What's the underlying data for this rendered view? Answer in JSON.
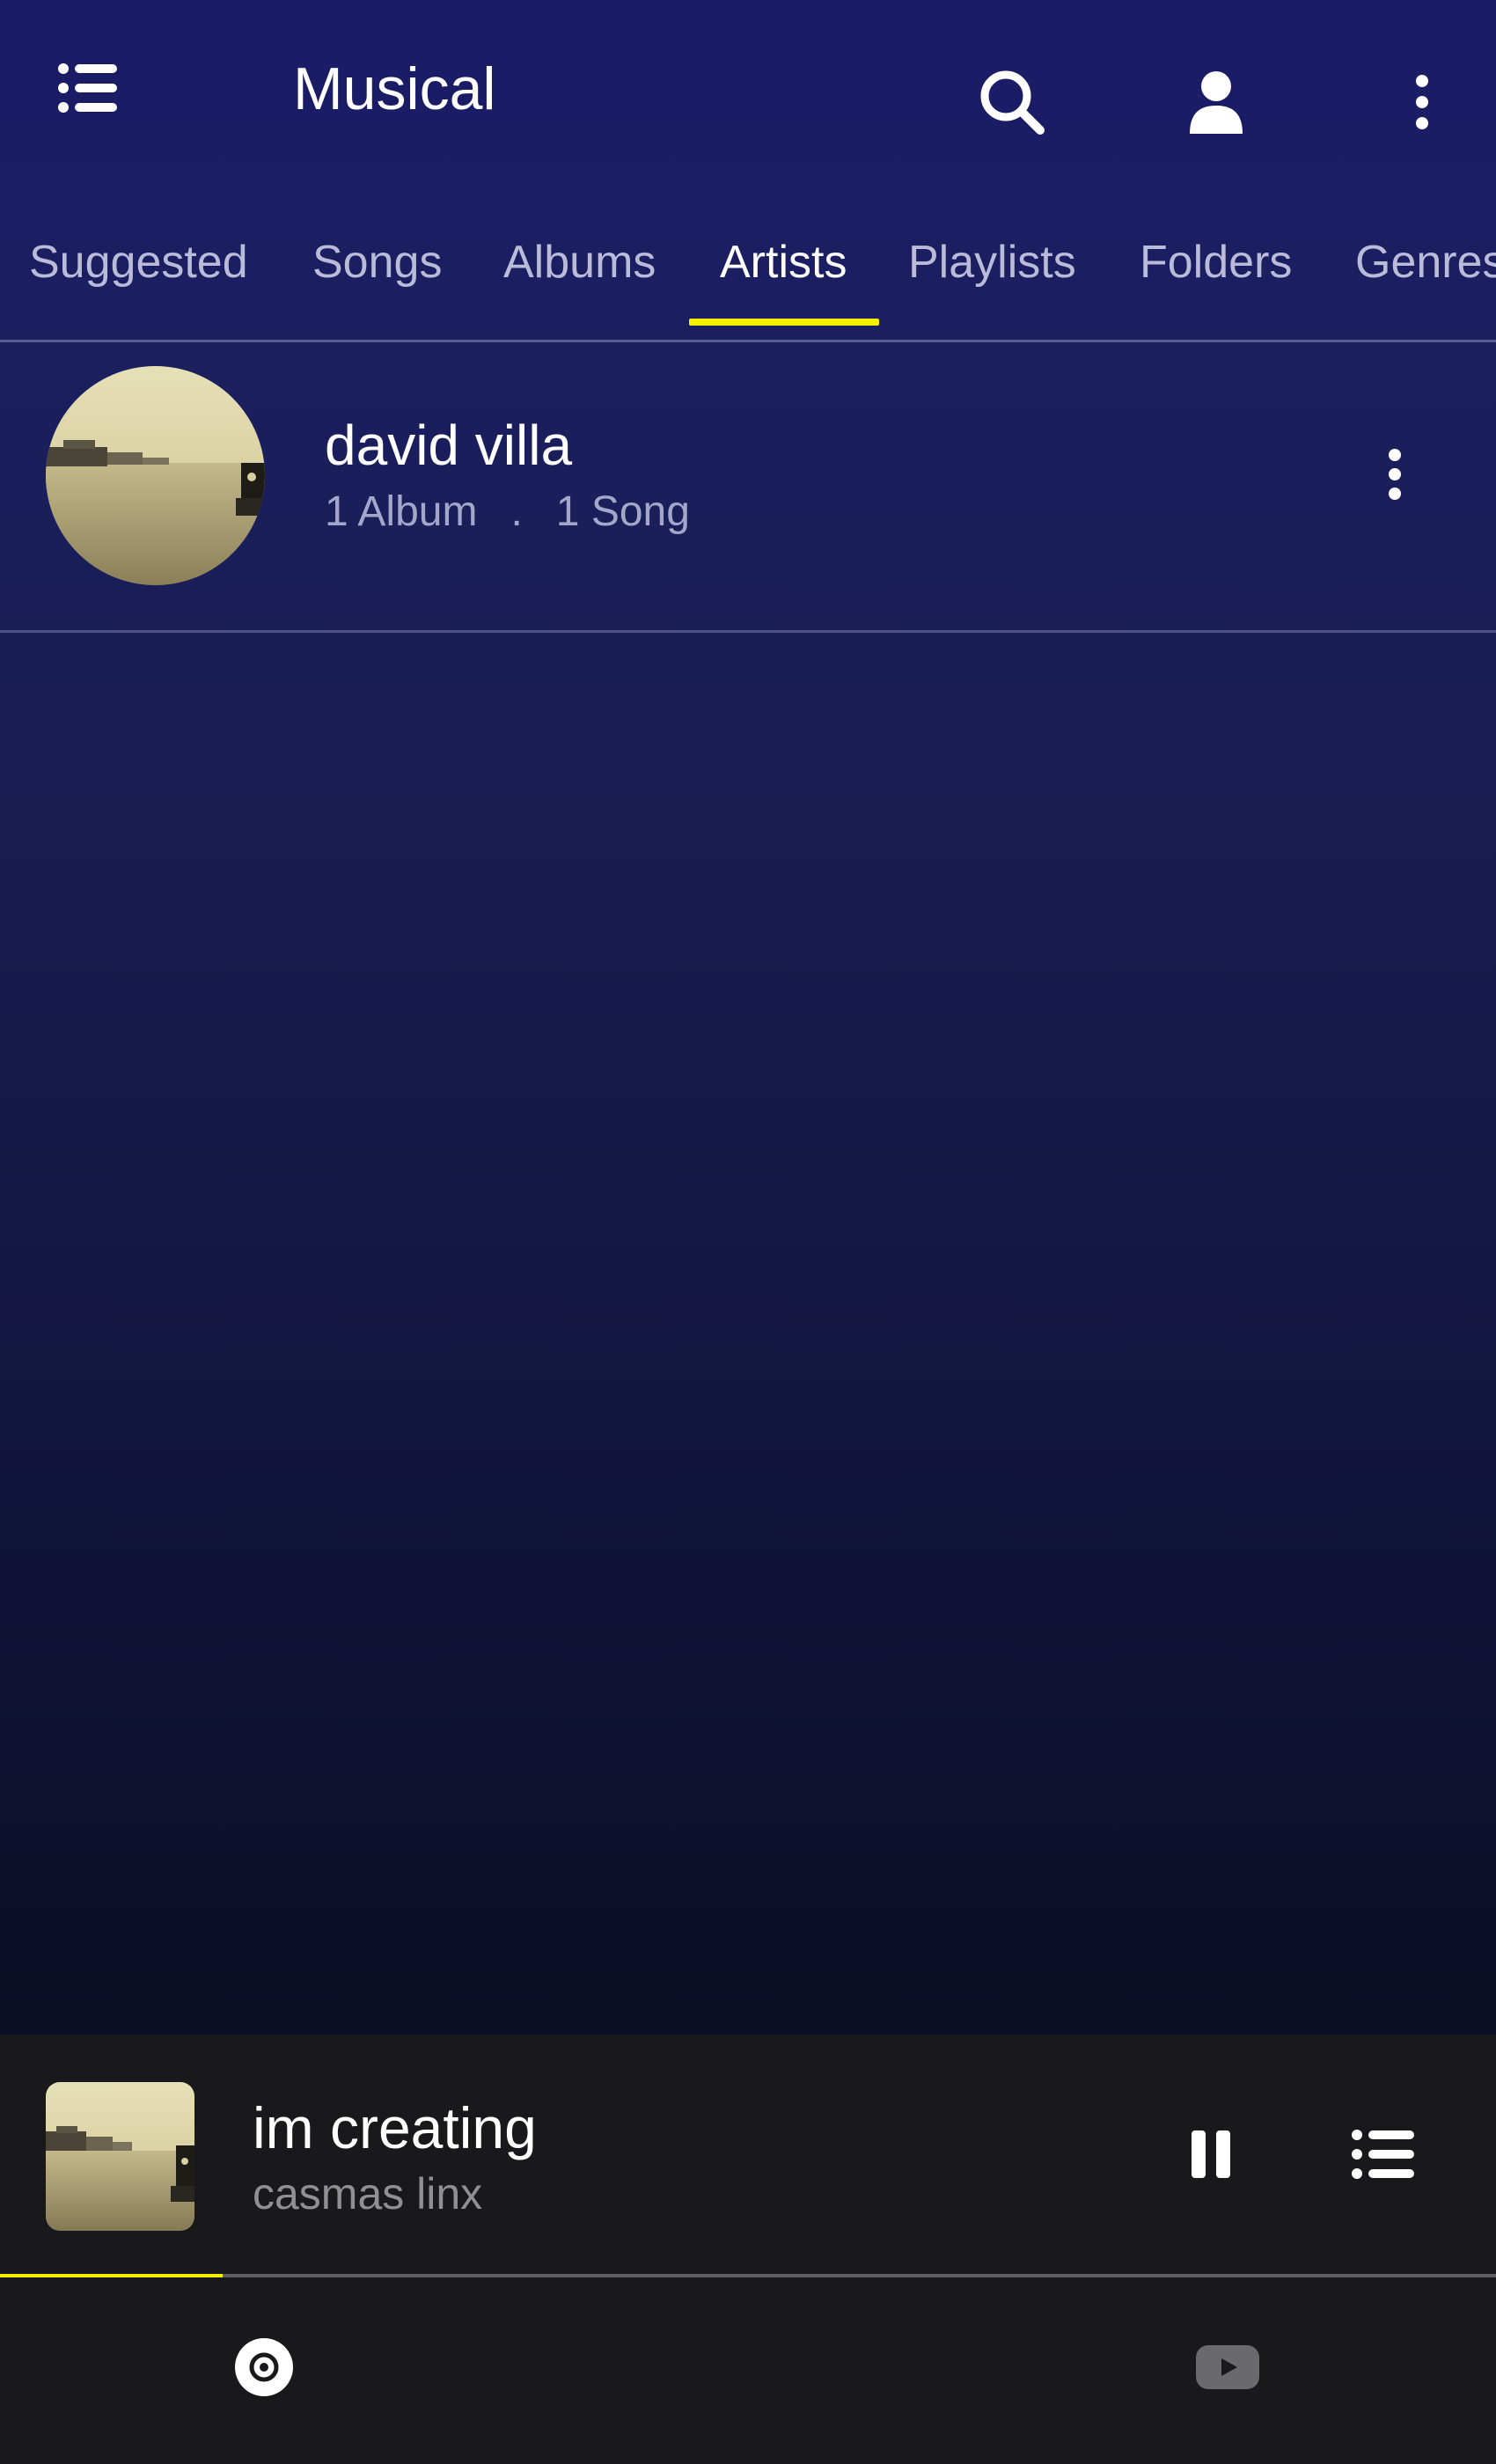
{
  "app": {
    "title": "Musical"
  },
  "tabs": [
    {
      "label": "Suggested",
      "active": false
    },
    {
      "label": "Songs",
      "active": false
    },
    {
      "label": "Albums",
      "active": false
    },
    {
      "label": "Artists",
      "active": true
    },
    {
      "label": "Playlists",
      "active": false
    },
    {
      "label": "Folders",
      "active": false
    },
    {
      "label": "Genres",
      "active": false
    }
  ],
  "artists": [
    {
      "name": "david villa",
      "albums": "1 Album",
      "separator": ".",
      "songs": "1 Song"
    }
  ],
  "now_playing": {
    "title": "im creating",
    "artist": "casmas linx",
    "progress_fraction": 0.149
  },
  "icons": {
    "menu": "list-menu-icon",
    "search": "search-icon",
    "account": "person-icon",
    "overflow": "more-vertical-icon",
    "pause": "pause-icon",
    "queue": "queue-list-icon",
    "nav_music": "music-disc-icon",
    "nav_video": "youtube-play-icon"
  },
  "colors": {
    "background": "#1a1c68",
    "accent": "#f4f000",
    "player_background": "#19191b"
  }
}
